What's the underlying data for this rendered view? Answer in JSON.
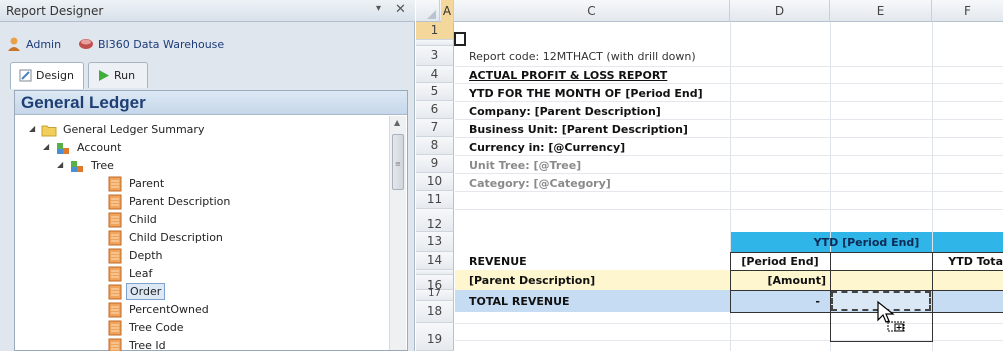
{
  "panel": {
    "title": "Report Designer",
    "pin_glyph": "▾",
    "close_glyph": "✕",
    "connection": {
      "user": "Admin",
      "source": "BI360 Data Warehouse"
    },
    "tabs": [
      {
        "label": "Design",
        "active": true
      },
      {
        "label": "Run",
        "active": false
      }
    ],
    "section_title": "General Ledger",
    "tree": [
      {
        "label": "General Ledger Summary",
        "type": "folder",
        "depth": 0,
        "expanded": true
      },
      {
        "label": "Account",
        "type": "dimension",
        "depth": 1,
        "expanded": true
      },
      {
        "label": "Tree",
        "type": "dimension",
        "depth": 2,
        "expanded": true
      },
      {
        "label": "Parent",
        "type": "field",
        "depth": 3
      },
      {
        "label": "Parent Description",
        "type": "field",
        "depth": 3
      },
      {
        "label": "Child",
        "type": "field",
        "depth": 3
      },
      {
        "label": "Child Description",
        "type": "field",
        "depth": 3
      },
      {
        "label": "Depth",
        "type": "field",
        "depth": 3
      },
      {
        "label": "Leaf",
        "type": "field",
        "depth": 3
      },
      {
        "label": "Order",
        "type": "field",
        "depth": 3,
        "selected": true
      },
      {
        "label": "PercentOwned",
        "type": "field",
        "depth": 3
      },
      {
        "label": "Tree Code",
        "type": "field",
        "depth": 3
      },
      {
        "label": "Tree Id",
        "type": "field",
        "depth": 3
      }
    ]
  },
  "sheet": {
    "columns": [
      "A",
      "C",
      "D",
      "E",
      "F"
    ],
    "selected_column": "A",
    "rows": [
      "1",
      "3",
      "4",
      "5",
      "6",
      "7",
      "8",
      "9",
      "10",
      "11",
      "12",
      "13",
      "14",
      "16",
      "17",
      "18",
      "19"
    ],
    "selected_row": "1",
    "cells": {
      "c3": "Report code: 12MTHACT (with drill down)",
      "c4": "ACTUAL PROFIT & LOSS REPORT",
      "c5": "YTD FOR THE MONTH OF [Period End]",
      "c6": "Company: [Parent Description]",
      "c7": "Business Unit: [Parent Description]",
      "c8": "Currency in: [@Currency]",
      "c9": "Unit Tree: [@Tree]",
      "c10": "Category: [@Category]",
      "e12": "YTD [Period End]",
      "c13": "REVENUE",
      "d13": "[Period End]",
      "f13": "YTD Tota",
      "c14": "[Parent Description]",
      "d14": "[Amount]",
      "c16": "TOTAL REVENUE",
      "d16": "-"
    },
    "colors": {
      "header_band": "#2fb5e8",
      "highlight_row": "#fdf6cf",
      "total_row": "#c6dcf2",
      "selected_header": "#f4d79b"
    }
  }
}
